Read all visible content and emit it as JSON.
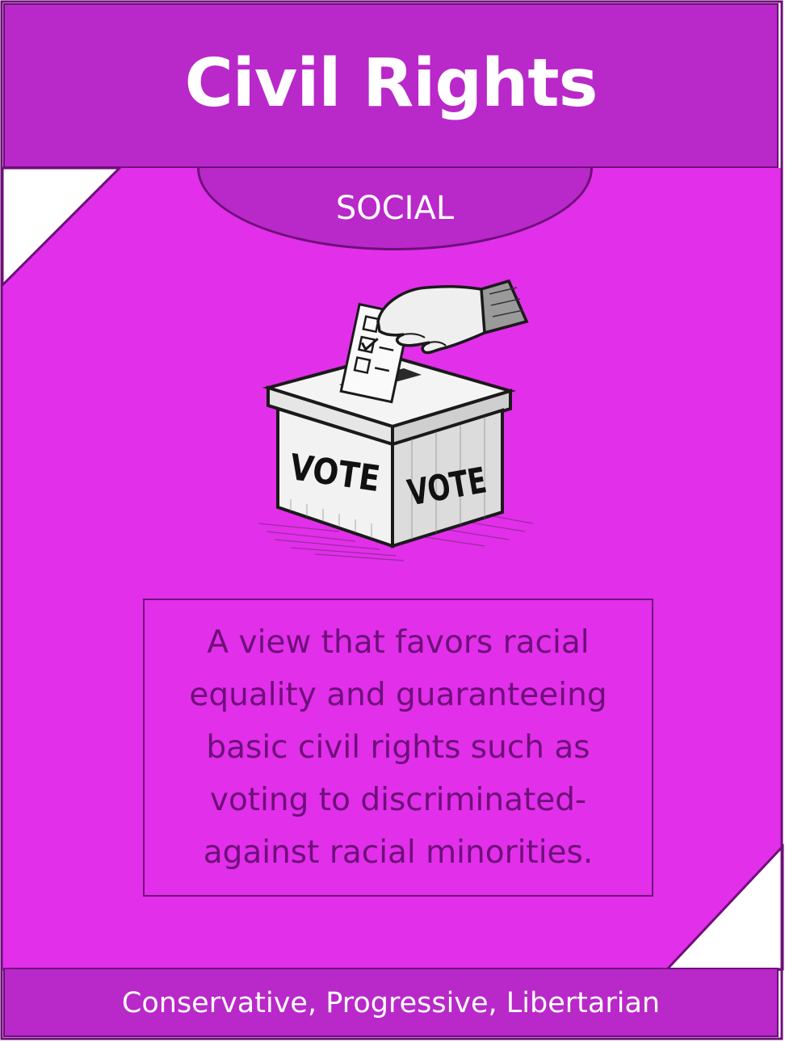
{
  "card": {
    "title": "Civil Rights",
    "category": "SOCIAL",
    "description": "A view that favors racial equality and guaranteeing basic civil rights such as voting to discriminated-against racial minorities.",
    "footer": "Conservative, Progressive, Libertarian"
  },
  "illustration": {
    "icon": "ballot-box-icon",
    "box_label_left": "VOTE",
    "box_label_right": "VOTE"
  },
  "colors": {
    "background": "#e22fea",
    "bar": "#b928c9",
    "border": "#6e0f7a",
    "text_dark": "#6e0f7a",
    "text_light": "#ffffff"
  }
}
